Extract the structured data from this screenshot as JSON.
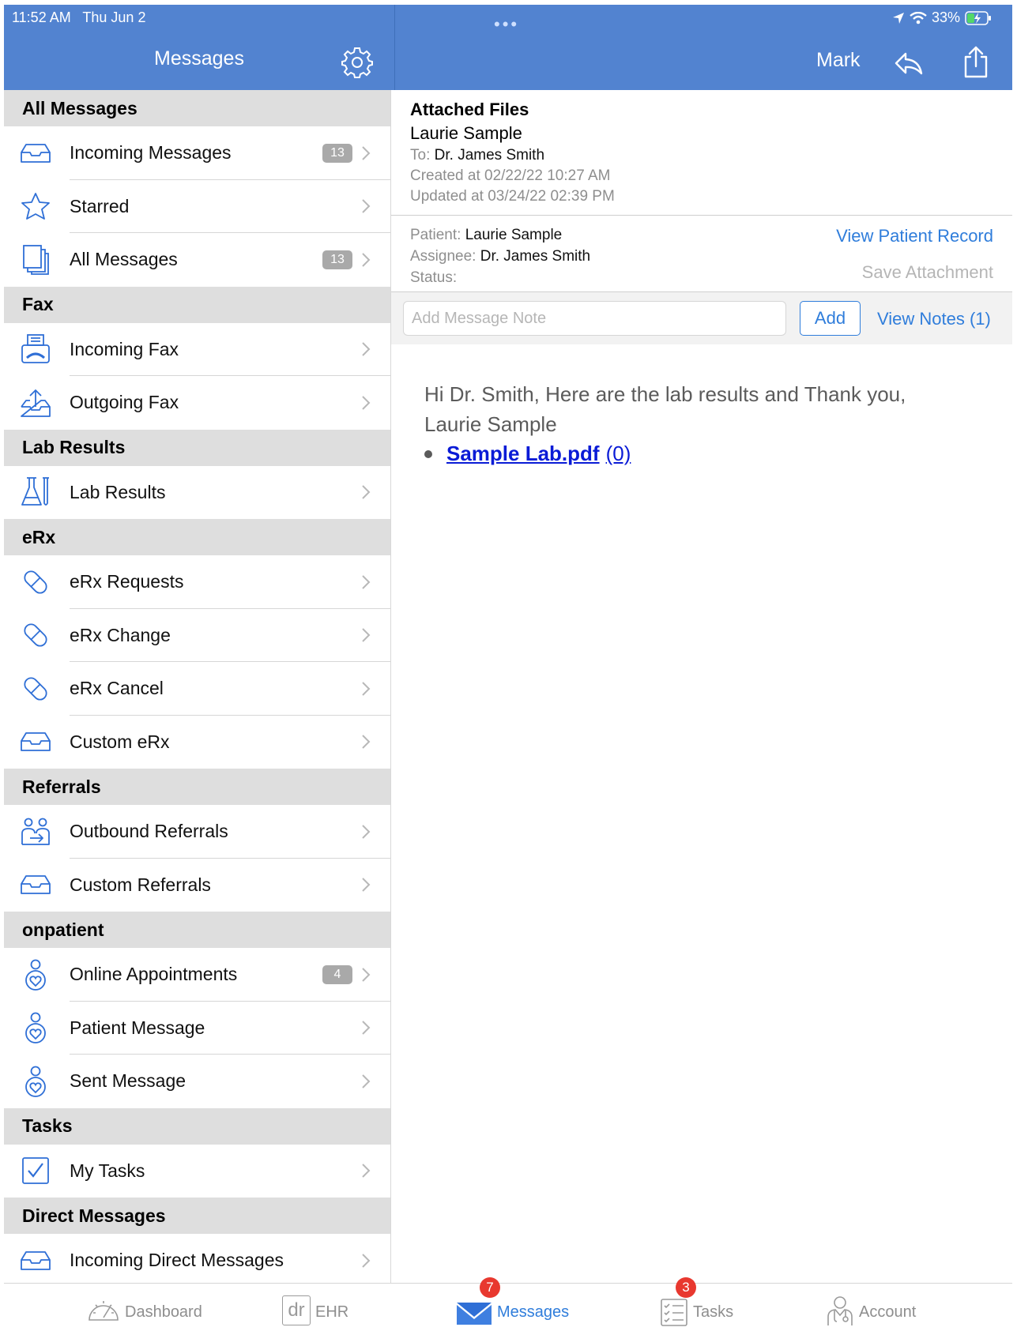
{
  "status_bar": {
    "time": "11:52 AM",
    "date": "Thu Jun 2",
    "battery": "33%"
  },
  "header": {
    "left_title": "Messages",
    "mark_label": "Mark"
  },
  "sidebar": {
    "sections": [
      {
        "title": "All Messages",
        "items": [
          {
            "label": "Incoming Messages",
            "icon": "inbox-icon",
            "badge": "13"
          },
          {
            "label": "Starred",
            "icon": "star-icon"
          },
          {
            "label": "All Messages",
            "icon": "documents-icon",
            "badge": "13"
          }
        ]
      },
      {
        "title": "Fax",
        "items": [
          {
            "label": "Incoming Fax",
            "icon": "fax-icon"
          },
          {
            "label": "Outgoing Fax",
            "icon": "outbox-icon"
          }
        ]
      },
      {
        "title": "Lab Results",
        "items": [
          {
            "label": "Lab Results",
            "icon": "flask-icon"
          }
        ]
      },
      {
        "title": "eRx",
        "items": [
          {
            "label": "eRx Requests",
            "icon": "pill-icon"
          },
          {
            "label": "eRx Change",
            "icon": "pill-icon"
          },
          {
            "label": "eRx Cancel",
            "icon": "pill-icon"
          },
          {
            "label": "Custom eRx",
            "icon": "inbox-icon"
          }
        ]
      },
      {
        "title": "Referrals",
        "items": [
          {
            "label": "Outbound Referrals",
            "icon": "referral-icon"
          },
          {
            "label": "Custom Referrals",
            "icon": "inbox-icon"
          }
        ]
      },
      {
        "title": "onpatient",
        "items": [
          {
            "label": "Online Appointments",
            "icon": "patient-icon",
            "badge": "4"
          },
          {
            "label": "Patient Message",
            "icon": "patient-icon"
          },
          {
            "label": "Sent Message",
            "icon": "patient-icon"
          }
        ]
      },
      {
        "title": "Tasks",
        "items": [
          {
            "label": "My Tasks",
            "icon": "checkbox-icon"
          }
        ]
      },
      {
        "title": "Direct Messages",
        "items": [
          {
            "label": "Incoming Direct Messages",
            "icon": "inbox-icon"
          }
        ]
      }
    ]
  },
  "message": {
    "subject": "Attached Files",
    "sender": "Laurie Sample",
    "to_label": "To:",
    "to_value": "Dr. James Smith",
    "created": "Created at 02/22/22 10:27 AM",
    "updated": "Updated at 03/24/22 02:39 PM",
    "patient_label": "Patient:",
    "patient_value": "Laurie Sample",
    "assignee_label": "Assignee:",
    "assignee_value": "Dr. James Smith",
    "status_label": "Status:",
    "view_patient_record": "View Patient Record",
    "save_attachment": "Save Attachment",
    "note_placeholder": "Add Message Note",
    "add_label": "Add",
    "view_notes": "View Notes (1)",
    "body_line1": "Hi Dr. Smith, Here are the lab results and Thank you,",
    "body_line2": "Laurie Sample",
    "attachment_name": "Sample Lab.pdf",
    "attachment_count": "(0)"
  },
  "tabbar": {
    "tabs": [
      {
        "label": "Dashboard"
      },
      {
        "label": "EHR",
        "icon_text": "dr"
      },
      {
        "label": "Messages",
        "badge": "7"
      },
      {
        "label": "Tasks",
        "badge": "3"
      },
      {
        "label": "Account"
      }
    ]
  },
  "colors": {
    "header": "#5283d0",
    "accent": "#2f7ddb",
    "badge_red": "#e8382f",
    "icon_blue": "#2f6fd6"
  }
}
